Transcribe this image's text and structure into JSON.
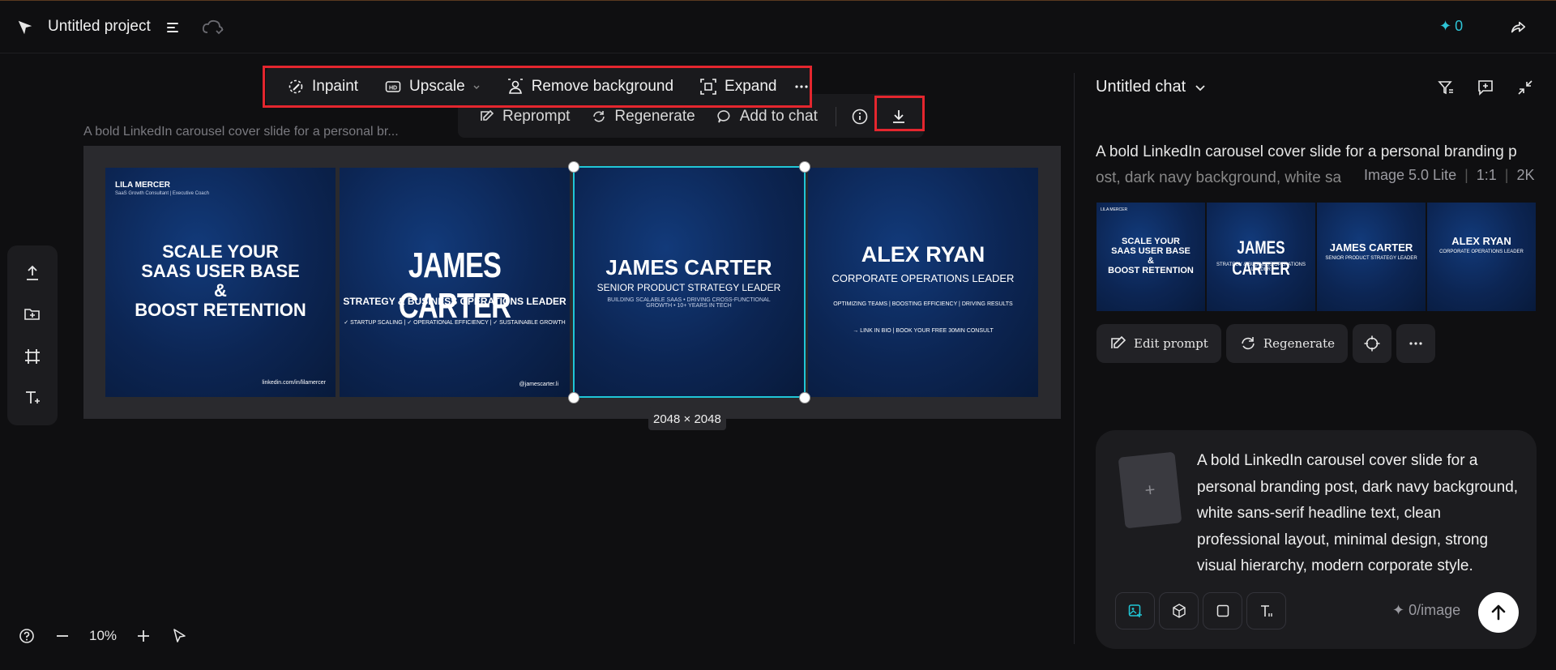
{
  "header": {
    "project_title": "Untitled project",
    "credits": "0"
  },
  "toolbar": {
    "inpaint": "Inpaint",
    "upscale": "Upscale",
    "remove_background": "Remove background",
    "expand": "Expand"
  },
  "subtoolbar": {
    "reprompt": "Reprompt",
    "regenerate": "Regenerate",
    "add_to_chat": "Add to chat"
  },
  "canvas": {
    "prompt_caption": "A bold LinkedIn carousel cover slide for a personal br...",
    "dimensions": "2048 × 2048",
    "zoom": "10%"
  },
  "slides": [
    {
      "name": "LILA MERCER",
      "subtitle": "SaaS Growth Consultant | Executive Coach",
      "headline1": "SCALE YOUR",
      "headline2": "SAAS USER BASE",
      "headline3": "&",
      "headline4": "BOOST RETENTION",
      "footer": "linkedin.com/in/lilamercer"
    },
    {
      "headline": "JAMES CARTER",
      "role": "STRATEGY & BUSINESS OPERATIONS LEADER",
      "tags": "✓ STARTUP SCALING | ✓ OPERATIONAL EFFICIENCY | ✓ SUSTAINABLE GROWTH",
      "footer": "@jamescarter.li"
    },
    {
      "headline": "JAMES CARTER",
      "role": "SENIOR PRODUCT STRATEGY LEADER",
      "tags1": "BUILDING SCALABLE SAAS • DRIVING CROSS-FUNCTIONAL",
      "tags2": "GROWTH • 10+ YEARS IN TECH"
    },
    {
      "headline": "ALEX RYAN",
      "role": "CORPORATE OPERATIONS LEADER",
      "tags": "OPTIMIZING TEAMS | BOOSTING EFFICIENCY | DRIVING RESULTS",
      "cta": "→ LINK IN BIO | BOOK YOUR FREE 30MIN CONSULT"
    }
  ],
  "chat": {
    "title": "Untitled chat",
    "prompt_line1": "A bold LinkedIn carousel cover slide for a personal branding p",
    "prompt_line2": "ost, dark navy background, white sa",
    "model": "Image 5.0 Lite",
    "ratio": "1:1",
    "resolution": "2K",
    "edit_prompt": "Edit prompt",
    "regenerate": "Regenerate"
  },
  "composer": {
    "text": "A bold LinkedIn carousel cover slide for a personal branding post, dark navy background, white sans-serif headline text, clean professional layout, minimal design, strong visual hierarchy, modern corporate style.",
    "cost": "0/image"
  },
  "colors": {
    "accent": "#20c6d6",
    "highlight": "#e4262e",
    "background": "#0f0f11",
    "slide_navy": "#0c2553"
  }
}
